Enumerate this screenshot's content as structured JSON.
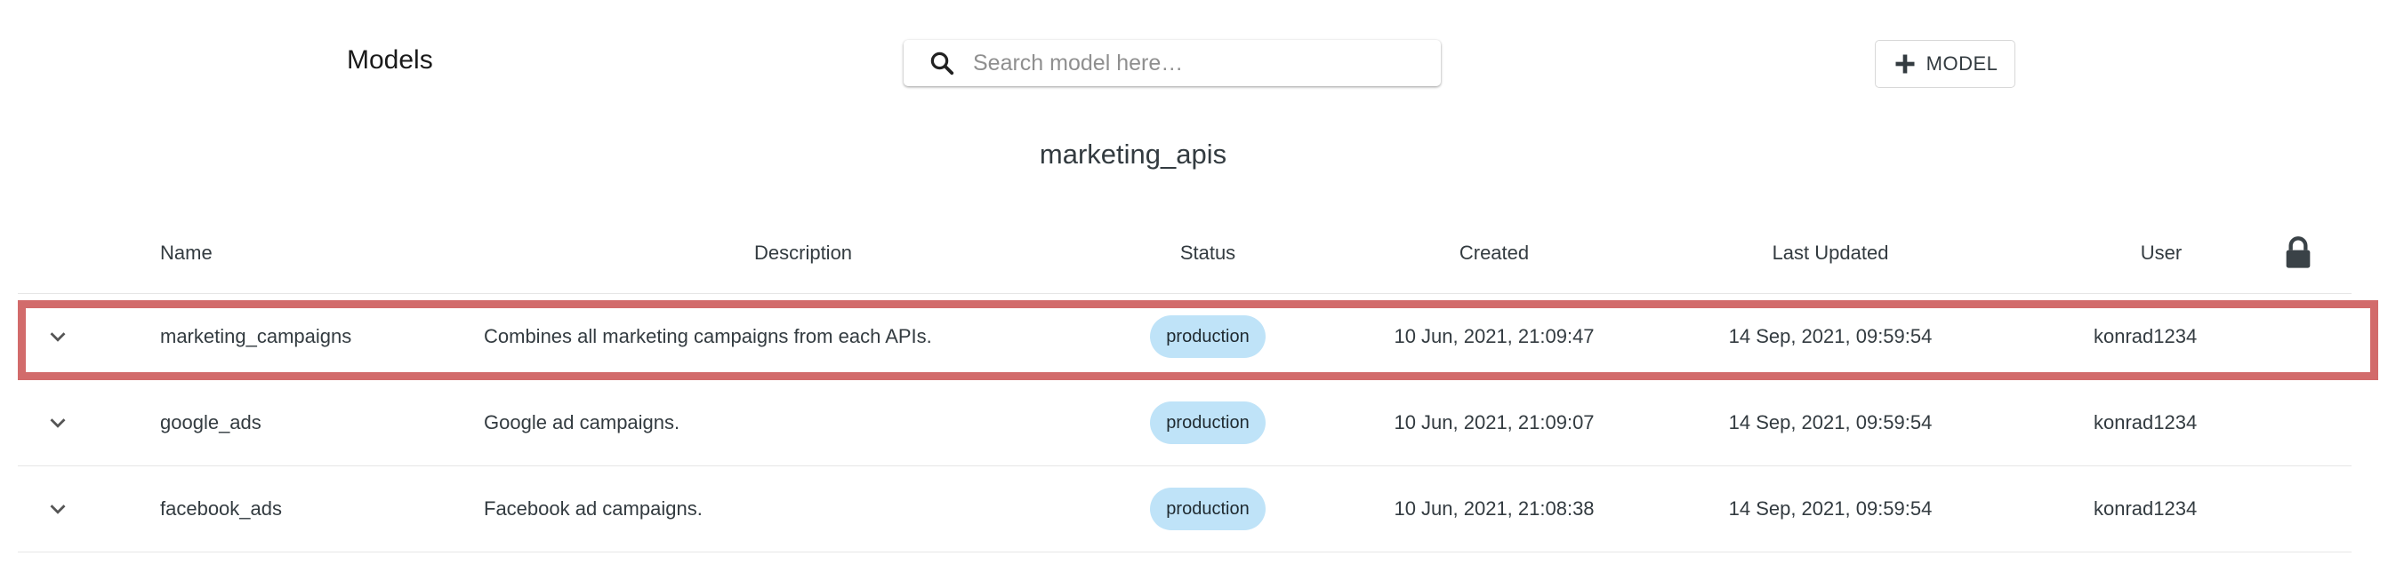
{
  "header": {
    "title": "Models",
    "search_placeholder": "Search model here…",
    "add_button_label": "MODEL"
  },
  "group": {
    "title": "marketing_apis"
  },
  "table": {
    "columns": {
      "name": "Name",
      "description": "Description",
      "status": "Status",
      "created": "Created",
      "last_updated": "Last Updated",
      "user": "User"
    },
    "rows": [
      {
        "name": "marketing_campaigns",
        "description": "Combines all marketing campaigns from each APIs.",
        "status": "production",
        "created": "10 Jun, 2021, 21:09:47",
        "last_updated": "14 Sep, 2021, 09:59:54",
        "user": "konrad1234"
      },
      {
        "name": "google_ads",
        "description": "Google ad campaigns.",
        "status": "production",
        "created": "10 Jun, 2021, 21:09:07",
        "last_updated": "14 Sep, 2021, 09:59:54",
        "user": "konrad1234"
      },
      {
        "name": "facebook_ads",
        "description": "Facebook ad campaigns.",
        "status": "production",
        "created": "10 Jun, 2021, 21:08:38",
        "last_updated": "14 Sep, 2021, 09:59:54",
        "user": "konrad1234"
      }
    ]
  },
  "icons": {
    "search": "search-icon",
    "add": "plus-icon",
    "lock": "lock-icon",
    "expand": "chevron-down-icon"
  },
  "colors": {
    "status_badge": "#bfe3f8",
    "highlight_border": "#d26b6b",
    "text": "#333b40"
  }
}
